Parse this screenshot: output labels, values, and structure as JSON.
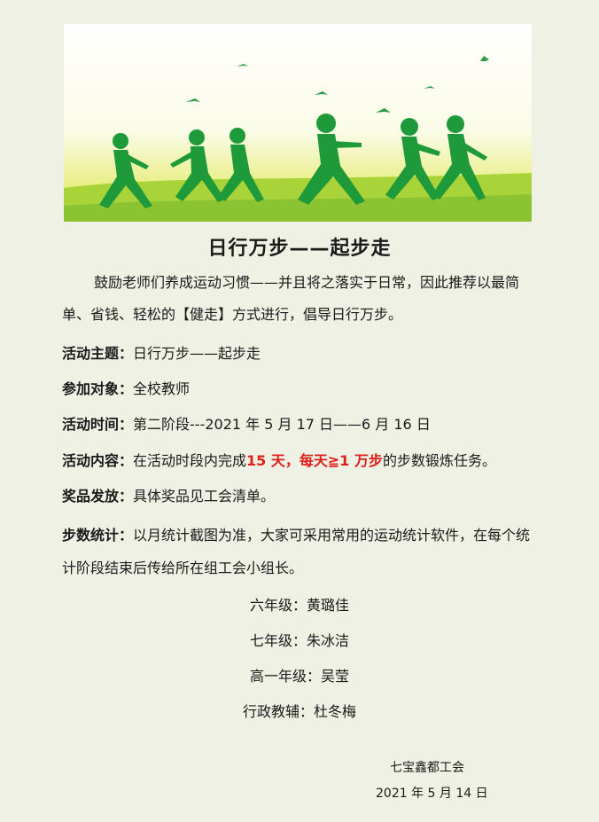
{
  "title": "日行万步——起步走",
  "intro": "鼓励老师们养成运动习惯——并且将之落实于日常，因此推荐以最简单、省钱、轻松的【健走】方式进行，倡导日行万步。",
  "items": [
    {
      "label": "活动主题：",
      "value": "日行万步——起步走"
    },
    {
      "label": "参加对象：",
      "value": "全校教师"
    },
    {
      "label": "活动时间：",
      "value": "第二阶段---2021 年 5 月 17 日——6 月 16 日"
    },
    {
      "label": "活动内容：",
      "value_before": "在活动时段内完成",
      "value_red": "15 天，每天≧1 万步",
      "value_after": "的步数锻炼任务。"
    },
    {
      "label": "奖品发放：",
      "value": "具体奖品见工会清单。"
    },
    {
      "label": "步数统计：",
      "value": "以月统计截图为准，大家可采用常用的运动统计软件，在每个统计阶段结束后传给所在组工会小组长。"
    }
  ],
  "contacts": [
    "六年级：黄璐佳",
    "七年级：朱冰洁",
    "高一年级：吴莹",
    "行政教辅：杜冬梅"
  ],
  "signature": {
    "org": "七宝鑫都工会",
    "date": "2021 年 5 月 14 日"
  },
  "colors": {
    "accent_red": "#e0211b",
    "figure_green": "#1f9a3a",
    "background": "#eef1e4"
  }
}
